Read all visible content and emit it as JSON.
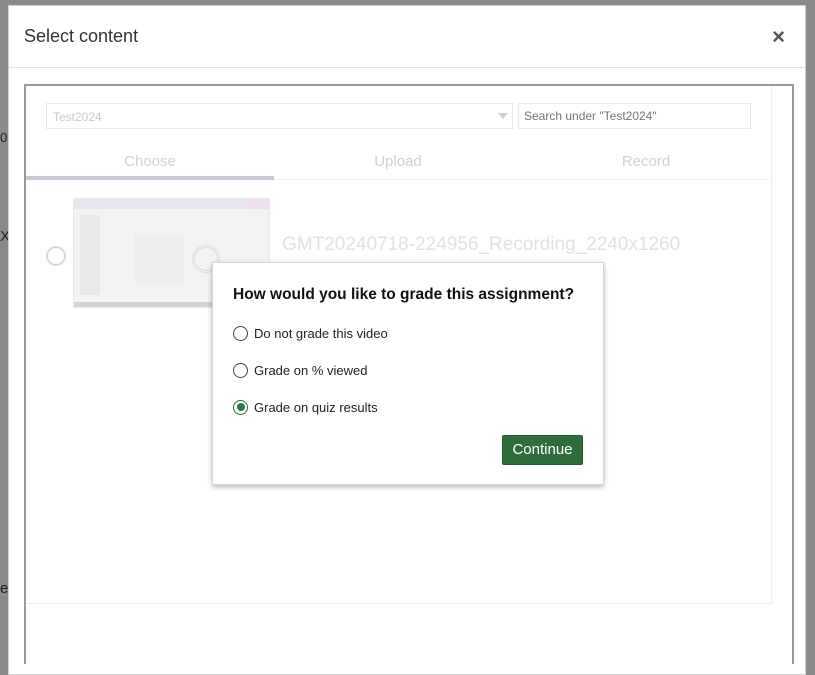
{
  "modal": {
    "title": "Select content",
    "close_label": "×"
  },
  "toolbar": {
    "category_value": "Test2024",
    "search_placeholder": "Search under \"Test2024\""
  },
  "tabs": [
    {
      "label": "Choose",
      "active": true
    },
    {
      "label": "Upload",
      "active": false
    },
    {
      "label": "Record",
      "active": false
    }
  ],
  "entry": {
    "title": "GMT20240718-224956_Recording_2240x1260"
  },
  "grade_dialog": {
    "question": "How would you like to grade this assignment?",
    "options": [
      {
        "label": "Do not grade this video",
        "selected": false
      },
      {
        "label": "Grade on % viewed",
        "selected": false
      },
      {
        "label": "Grade on quiz results",
        "selected": true
      }
    ],
    "continue_label": "Continue"
  },
  "background": {
    "fragments": [
      "0",
      "X",
      "e"
    ]
  },
  "colors": {
    "accent": "#2f6d3a",
    "overlay": "#8a8a8a"
  }
}
